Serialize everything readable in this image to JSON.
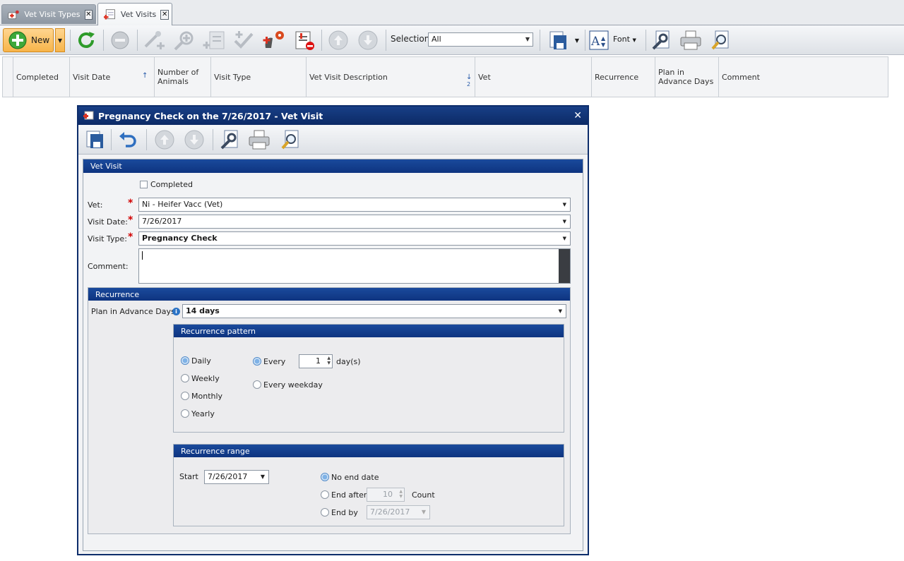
{
  "tabs": [
    {
      "label": "Vet Visit Types",
      "icon": "vet-types-icon",
      "active": false
    },
    {
      "label": "Vet Visits",
      "icon": "vet-visits-icon",
      "active": true
    }
  ],
  "toolbar": {
    "new_label": "New",
    "selection_label": "Selection",
    "selection_value": "All",
    "font_label": "Font"
  },
  "grid": {
    "columns": [
      "Completed",
      "Visit Date",
      "Number of Animals",
      "Visit Type",
      "Vet Visit Description",
      "Vet",
      "Recurrence",
      "Plan in Advance Days",
      "Comment"
    ],
    "sort_indicator_description": "2"
  },
  "dialog": {
    "title": "Pregnancy Check on the 7/26/2017 - Vet Visit",
    "section_title": "Vet Visit",
    "completed_label": "Completed",
    "completed_checked": false,
    "vet_label": "Vet:",
    "vet_value": "Ni - Heifer Vacc (Vet)",
    "visit_date_label": "Visit Date:",
    "visit_date_value": "7/26/2017",
    "visit_type_label": "Visit Type:",
    "visit_type_value": "Pregnancy Check",
    "comment_label": "Comment:",
    "comment_value": "",
    "recurrence_title": "Recurrence",
    "plan_label": "Plan in Advance Days:",
    "plan_value": "14 days",
    "pattern": {
      "title": "Recurrence pattern",
      "options": [
        "Daily",
        "Weekly",
        "Monthly",
        "Yearly"
      ],
      "selected": "Daily",
      "every_label": "Every",
      "every_value": "1",
      "days_label": "day(s)",
      "every_weekday_label": "Every weekday"
    },
    "range": {
      "title": "Recurrence range",
      "start_label": "Start",
      "start_value": "7/26/2017",
      "no_end_label": "No end date",
      "end_after_label": "End after",
      "end_after_value": "10",
      "count_label": "Count",
      "end_by_label": "End by",
      "end_by_value": "7/26/2017",
      "selected": "No end date"
    }
  },
  "colors": {
    "accent": "#0e3480",
    "new_button": "#f7b44a",
    "required": "#d10000"
  }
}
